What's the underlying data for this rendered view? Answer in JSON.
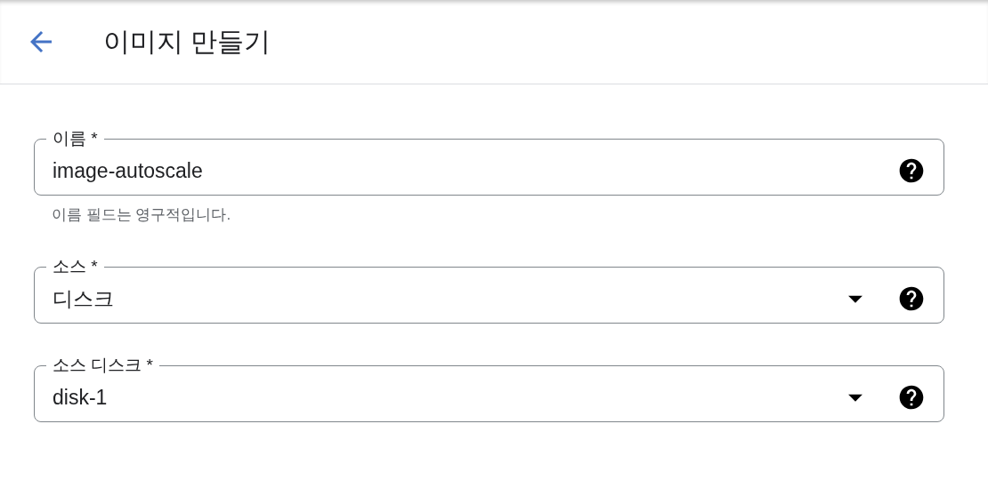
{
  "header": {
    "title": "이미지 만들기"
  },
  "fields": [
    {
      "kind": "text",
      "label": "이름 *",
      "value": "image-autoscale",
      "helper": "이름 필드는 영구적입니다."
    },
    {
      "kind": "select",
      "label": "소스 *",
      "value": "디스크"
    },
    {
      "kind": "select",
      "label": "소스 디스크 *",
      "value": "disk-1"
    }
  ]
}
